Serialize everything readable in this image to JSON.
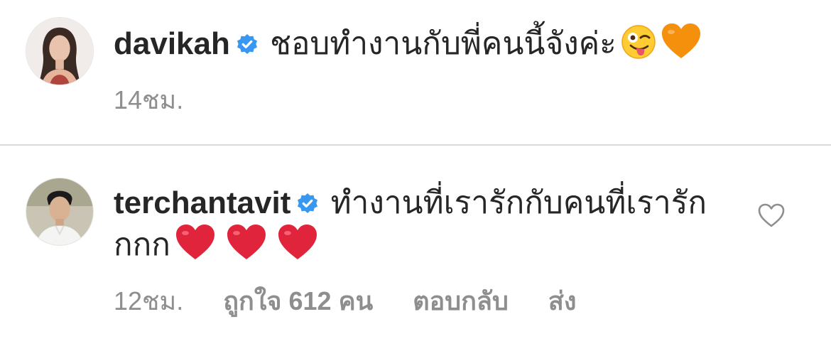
{
  "comments": [
    {
      "username": "davikah",
      "verified": true,
      "text": "ชอบทำงานกับพี่คนนี้จังค่ะ",
      "emojis": [
        "winking-tongue-emoji",
        "orange-heart-emoji"
      ],
      "time": "14ชม."
    },
    {
      "username": "terchantavit",
      "verified": true,
      "text": "ทำงานที่เรารักกับคนที่เรารักกกก",
      "emojis": [
        "red-heart-emoji",
        "red-heart-emoji",
        "red-heart-emoji"
      ],
      "time": "12ชม.",
      "likes": "ถูกใจ 612 คน",
      "reply": "ตอบกลับ",
      "send": "ส่ง"
    }
  ],
  "colors": {
    "text": "#262626",
    "meta": "#8e8e8e",
    "verified": "#3897f0",
    "divider": "#dbdbdb",
    "red_heart": "#e0243b",
    "orange_heart": "#f4900c"
  },
  "icons": [
    "verified-badge-icon",
    "like-heart-icon"
  ]
}
